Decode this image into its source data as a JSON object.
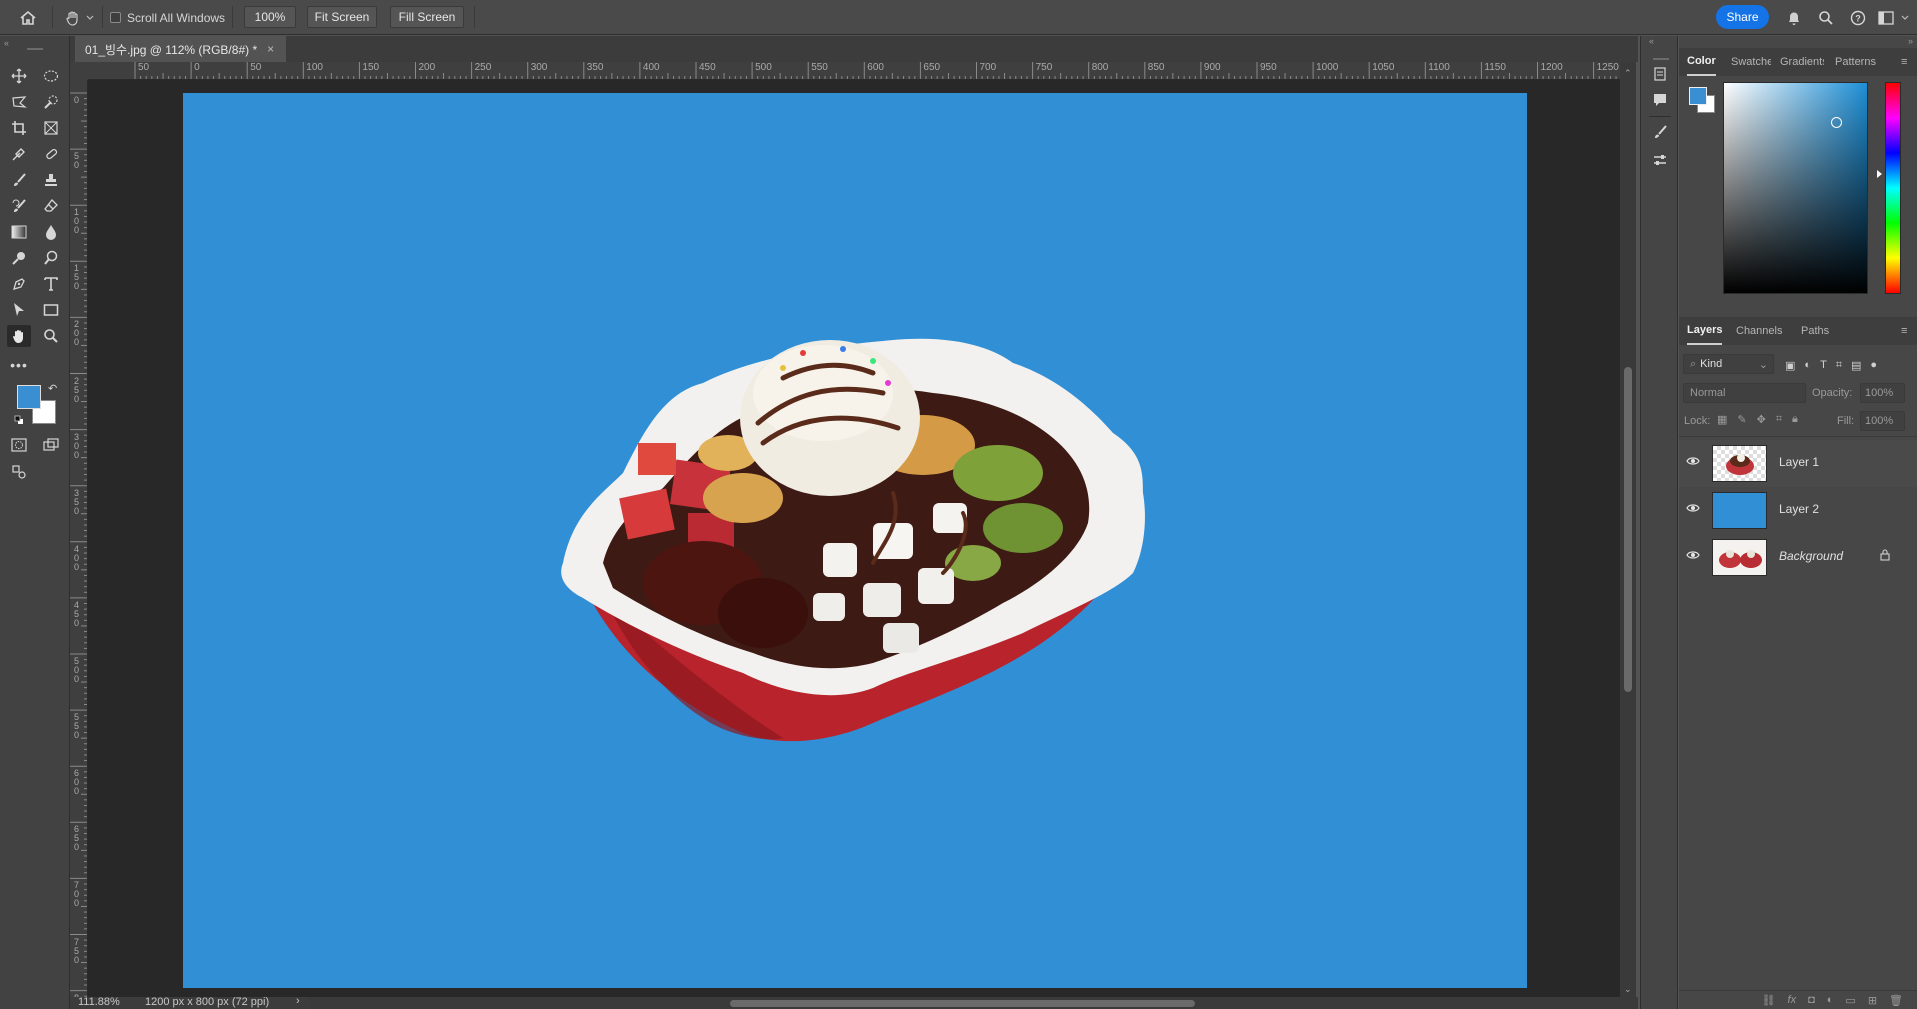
{
  "options_bar": {
    "scroll_all_label": "Scroll All Windows",
    "zoom_value": "100%",
    "fit_screen": "Fit Screen",
    "fill_screen": "Fill Screen",
    "share": "Share"
  },
  "document": {
    "tab_title": "01_빙수.jpg @ 112% (RGB/8#) *"
  },
  "rulers": {
    "horizontal": [
      "50",
      "0",
      "50",
      "100",
      "150",
      "200",
      "250",
      "300",
      "350",
      "400",
      "450",
      "500",
      "550",
      "600",
      "650",
      "700",
      "750",
      "800",
      "850",
      "900",
      "950",
      "1000",
      "1050",
      "1100",
      "1150",
      "1200",
      "1250"
    ],
    "vertical": [
      "0",
      "50",
      "100",
      "150",
      "200",
      "250",
      "300",
      "350",
      "400",
      "450",
      "500",
      "550",
      "600",
      "650",
      "700",
      "750",
      "8"
    ]
  },
  "status": {
    "zoom": "111.88%",
    "dimensions": "1200 px x 800 px (72 ppi)"
  },
  "color_panel": {
    "tabs": [
      "Color",
      "Swatches",
      "Gradients",
      "Patterns"
    ],
    "foreground": "#3a8fd3",
    "background": "#ffffff"
  },
  "layers_panel": {
    "tabs": [
      "Layers",
      "Channels",
      "Paths"
    ],
    "filter_label": "Kind",
    "blend_mode": "Normal",
    "opacity_label": "Opacity:",
    "opacity_value": "100%",
    "lock_label": "Lock:",
    "fill_label": "Fill:",
    "fill_value": "100%",
    "layers": [
      {
        "name": "Layer 1"
      },
      {
        "name": "Layer 2"
      },
      {
        "name": "Background"
      }
    ]
  },
  "colors": {
    "canvas_fill": "#318fd5",
    "accent": "#1473e6"
  }
}
